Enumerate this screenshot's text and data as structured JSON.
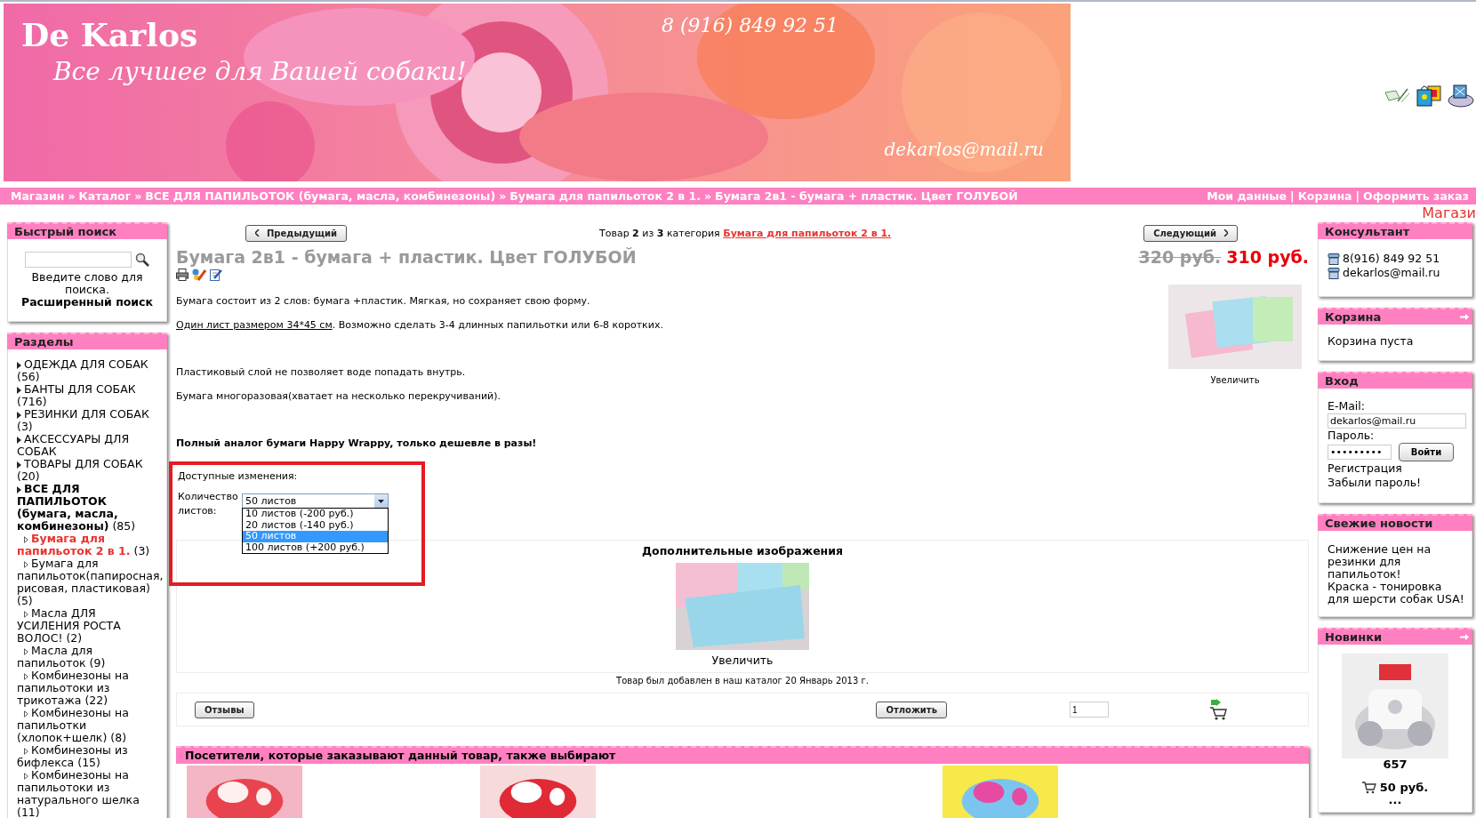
{
  "header": {
    "logo": "De Karlos",
    "slogan": "Все лучшее для Вашей собаки!",
    "phone": "8 (916) 849 92 51",
    "email": "dekarlos@mail.ru"
  },
  "breadcrumb": {
    "separator": "»",
    "items": [
      "Магазин",
      "Каталог",
      "ВСЕ ДЛЯ ПАПИЛЬОТОК (бумага, масла, комбинезоны)",
      "Бумага для папильоток 2 в 1.",
      "Бумага 2в1 - бумага + пластик. Цвет ГОЛУБОЙ"
    ]
  },
  "top_links": {
    "separator": "|",
    "items": [
      "Мои данные",
      "Корзина",
      "Оформить заказ"
    ]
  },
  "cut_text": "Магази",
  "quick_search": {
    "title": "Быстрый поиск",
    "more": false,
    "hint": "Введите слово для поиска.",
    "advanced": "Расширенный поиск"
  },
  "sections": {
    "title": "Разделы",
    "more": false,
    "items": [
      {
        "label": "ОДЕЖДА ДЛЯ СОБАК",
        "count": "(56)",
        "expanded": false,
        "selected": false
      },
      {
        "label": "БАНТЫ ДЛЯ СОБАК",
        "count": "(716)",
        "expanded": false,
        "selected": false
      },
      {
        "label": "РЕЗИНКИ ДЛЯ СОБАК",
        "count": "(3)",
        "expanded": false,
        "selected": false
      },
      {
        "label": "АКСЕССУАРЫ ДЛЯ СОБАК",
        "expanded": false,
        "selected": false
      },
      {
        "label": "ТОВАРЫ ДЛЯ СОБАК",
        "count": "(20)",
        "expanded": false,
        "selected": false
      },
      {
        "label": "ВСЕ ДЛЯ ПАПИЛЬОТОК (бумага, масла, комбинезоны)",
        "count": "(85)",
        "expanded": true,
        "selected": false,
        "children": [
          {
            "label": "Бумага для папильоток 2 в 1.",
            "count": "(3)",
            "selected": true
          },
          {
            "label": "Бумага для папильоток(папиросная, рисовая, пластиковая)",
            "count": "(5)",
            "selected": false
          },
          {
            "label": "Масла ДЛЯ УСИЛЕНИЯ РОСТА ВОЛОС!",
            "count": "(2)",
            "selected": false
          },
          {
            "label": "Масла для папильоток",
            "count": "(9)",
            "selected": false
          },
          {
            "label": "Комбинезоны на папильотоки из трикотажа",
            "count": "(22)",
            "selected": false
          },
          {
            "label": "Комбинезоны на папильотки (хлопок+шелк)",
            "count": "(8)",
            "selected": false
          },
          {
            "label": "Комбинезоны из бифлекса",
            "count": "(15)",
            "selected": false
          },
          {
            "label": "Комбинезоны на папильотоки из натурального шелка",
            "count": "(11)",
            "selected": false
          }
        ]
      }
    ]
  },
  "product": {
    "prev": "Предыдущий",
    "next": "Следующий",
    "position": "Товар **2** из **3** категория",
    "category_link": "Бумага для папильоток 2 в 1.",
    "title": "Бумага 2в1 - бумага + пластик. Цвет ГОЛУБОЙ",
    "old_price": "320 руб.",
    "price": "310 руб.",
    "image_caption": "Увеличить",
    "description": [
      {
        "kind": "text",
        "text": "Бумага состоит из 2 слов: бумага +пластик. Мягкая, но сохраняет свою форму."
      },
      {
        "kind": "link",
        "link": "Один лист размером 34*45 см",
        "text": ". Возможно сделать 3-4 длинных папильотки или 6-8 коротких."
      },
      {
        "kind": "gap"
      },
      {
        "kind": "text",
        "text": "Пластиковый слой не позволяет воде попадать внутрь."
      },
      {
        "kind": "text",
        "text": "Бумага многоразовая(хватает на несколько перекручиваний)."
      },
      {
        "kind": "gap"
      },
      {
        "kind": "bold",
        "text": "Полный аналог бумаги Happy Wrappy, только дешевле в разы!"
      }
    ],
    "options": {
      "title": "Доступные изменения:",
      "label": "Количество листов:",
      "value": "50 листов",
      "expanded": true,
      "items": [
        {
          "label": "10 листов (-200 руб.)",
          "selected": false
        },
        {
          "label": "20 листов (-140 руб.)",
          "selected": false
        },
        {
          "label": "50 листов",
          "selected": true
        },
        {
          "label": "100 листов (+200 руб.)",
          "selected": false
        }
      ]
    },
    "extra_images": {
      "title": "Дополнительные изображения",
      "caption": "Увеличить"
    },
    "added": "Товар был добавлен в наш каталог 20 Январь 2013 г.",
    "reviews": "Отзывы",
    "wishlist": "Отложить",
    "quantity": "1",
    "also_bought": {
      "title": "Посетители, которые заказывают данный товар, также выбирают"
    }
  },
  "consultant": {
    "title": "Консультант",
    "more": false,
    "phone": "8(916) 849 92 51",
    "email": "dekarlos@mail.ru"
  },
  "cart": {
    "title": "Корзина",
    "more": true,
    "text": "Корзина пуста"
  },
  "login": {
    "title": "Вход",
    "more": false,
    "email_label": "E-Mail:",
    "email": "dekarlos@mail.ru",
    "password_label": "Пароль:",
    "password": "•••••••••",
    "button": "Войти",
    "links": [
      "Регистрация",
      "Забыли пароль!"
    ]
  },
  "news": {
    "title": "Свежие новости",
    "more": false,
    "items": [
      "Снижение цен на резинки для папильоток!",
      "Краска - тонировка для шерсти собак USA!"
    ]
  },
  "new_items": {
    "title": "Новинки",
    "more": true,
    "name": "657",
    "price": "50 руб.",
    "more_text": "..."
  }
}
